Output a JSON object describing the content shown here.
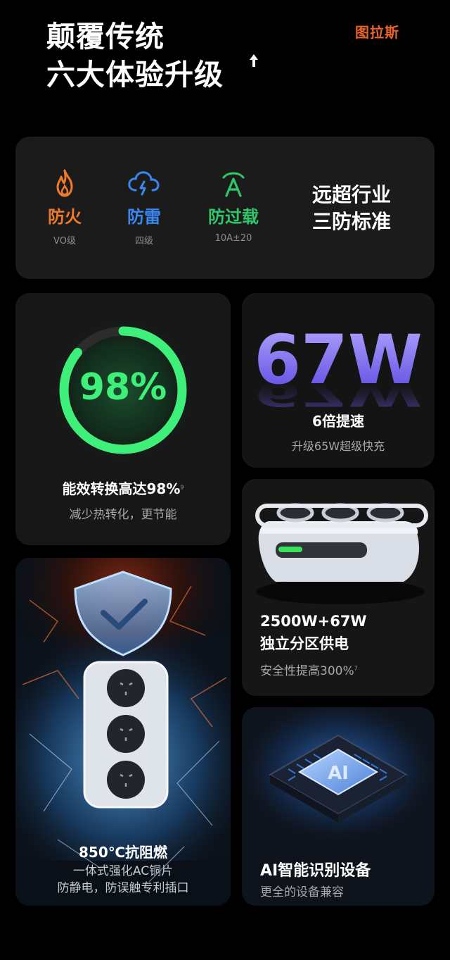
{
  "header": {
    "title_line1": "颠覆传统",
    "title_line2": "六大体验升级",
    "brand": "图拉斯",
    "arrow_icon": "up-arrow-icon"
  },
  "features": [
    {
      "label": "防火",
      "sub": "VO级",
      "color": "#f07a2a",
      "icon": "flame-icon"
    },
    {
      "label": "防雷",
      "sub": "四级",
      "color": "#3b86f0",
      "icon": "thunder-cloud-icon"
    },
    {
      "label": "防过载",
      "sub": "10A±20",
      "color": "#2ec86a",
      "icon": "overload-a-icon"
    }
  ],
  "standard": {
    "line1": "远超行业",
    "line2": "三防标准"
  },
  "efficiency": {
    "percent": "98%",
    "ring_fill": 0.86,
    "title": "能效转换高达98%",
    "footnote": "9",
    "sub": "减少热转化，更节能",
    "color": "#3ef07a"
  },
  "watt": {
    "big": "67W",
    "title": "6倍提速",
    "sub": "升级65W超级快充",
    "color": "#7a6cf5"
  },
  "zones": {
    "title1": "2500W+67W",
    "title2": "独立分区供电",
    "sub": "安全性提高300%",
    "footnote": "7"
  },
  "fire": {
    "title": "850℃抗阻燃",
    "sub1": "一体式强化AC铜片",
    "sub2": "防静电，防误触专利插口"
  },
  "ai": {
    "chip_label": "AI",
    "title": "AI智能识别设备",
    "sub": "更全的设备兼容"
  }
}
